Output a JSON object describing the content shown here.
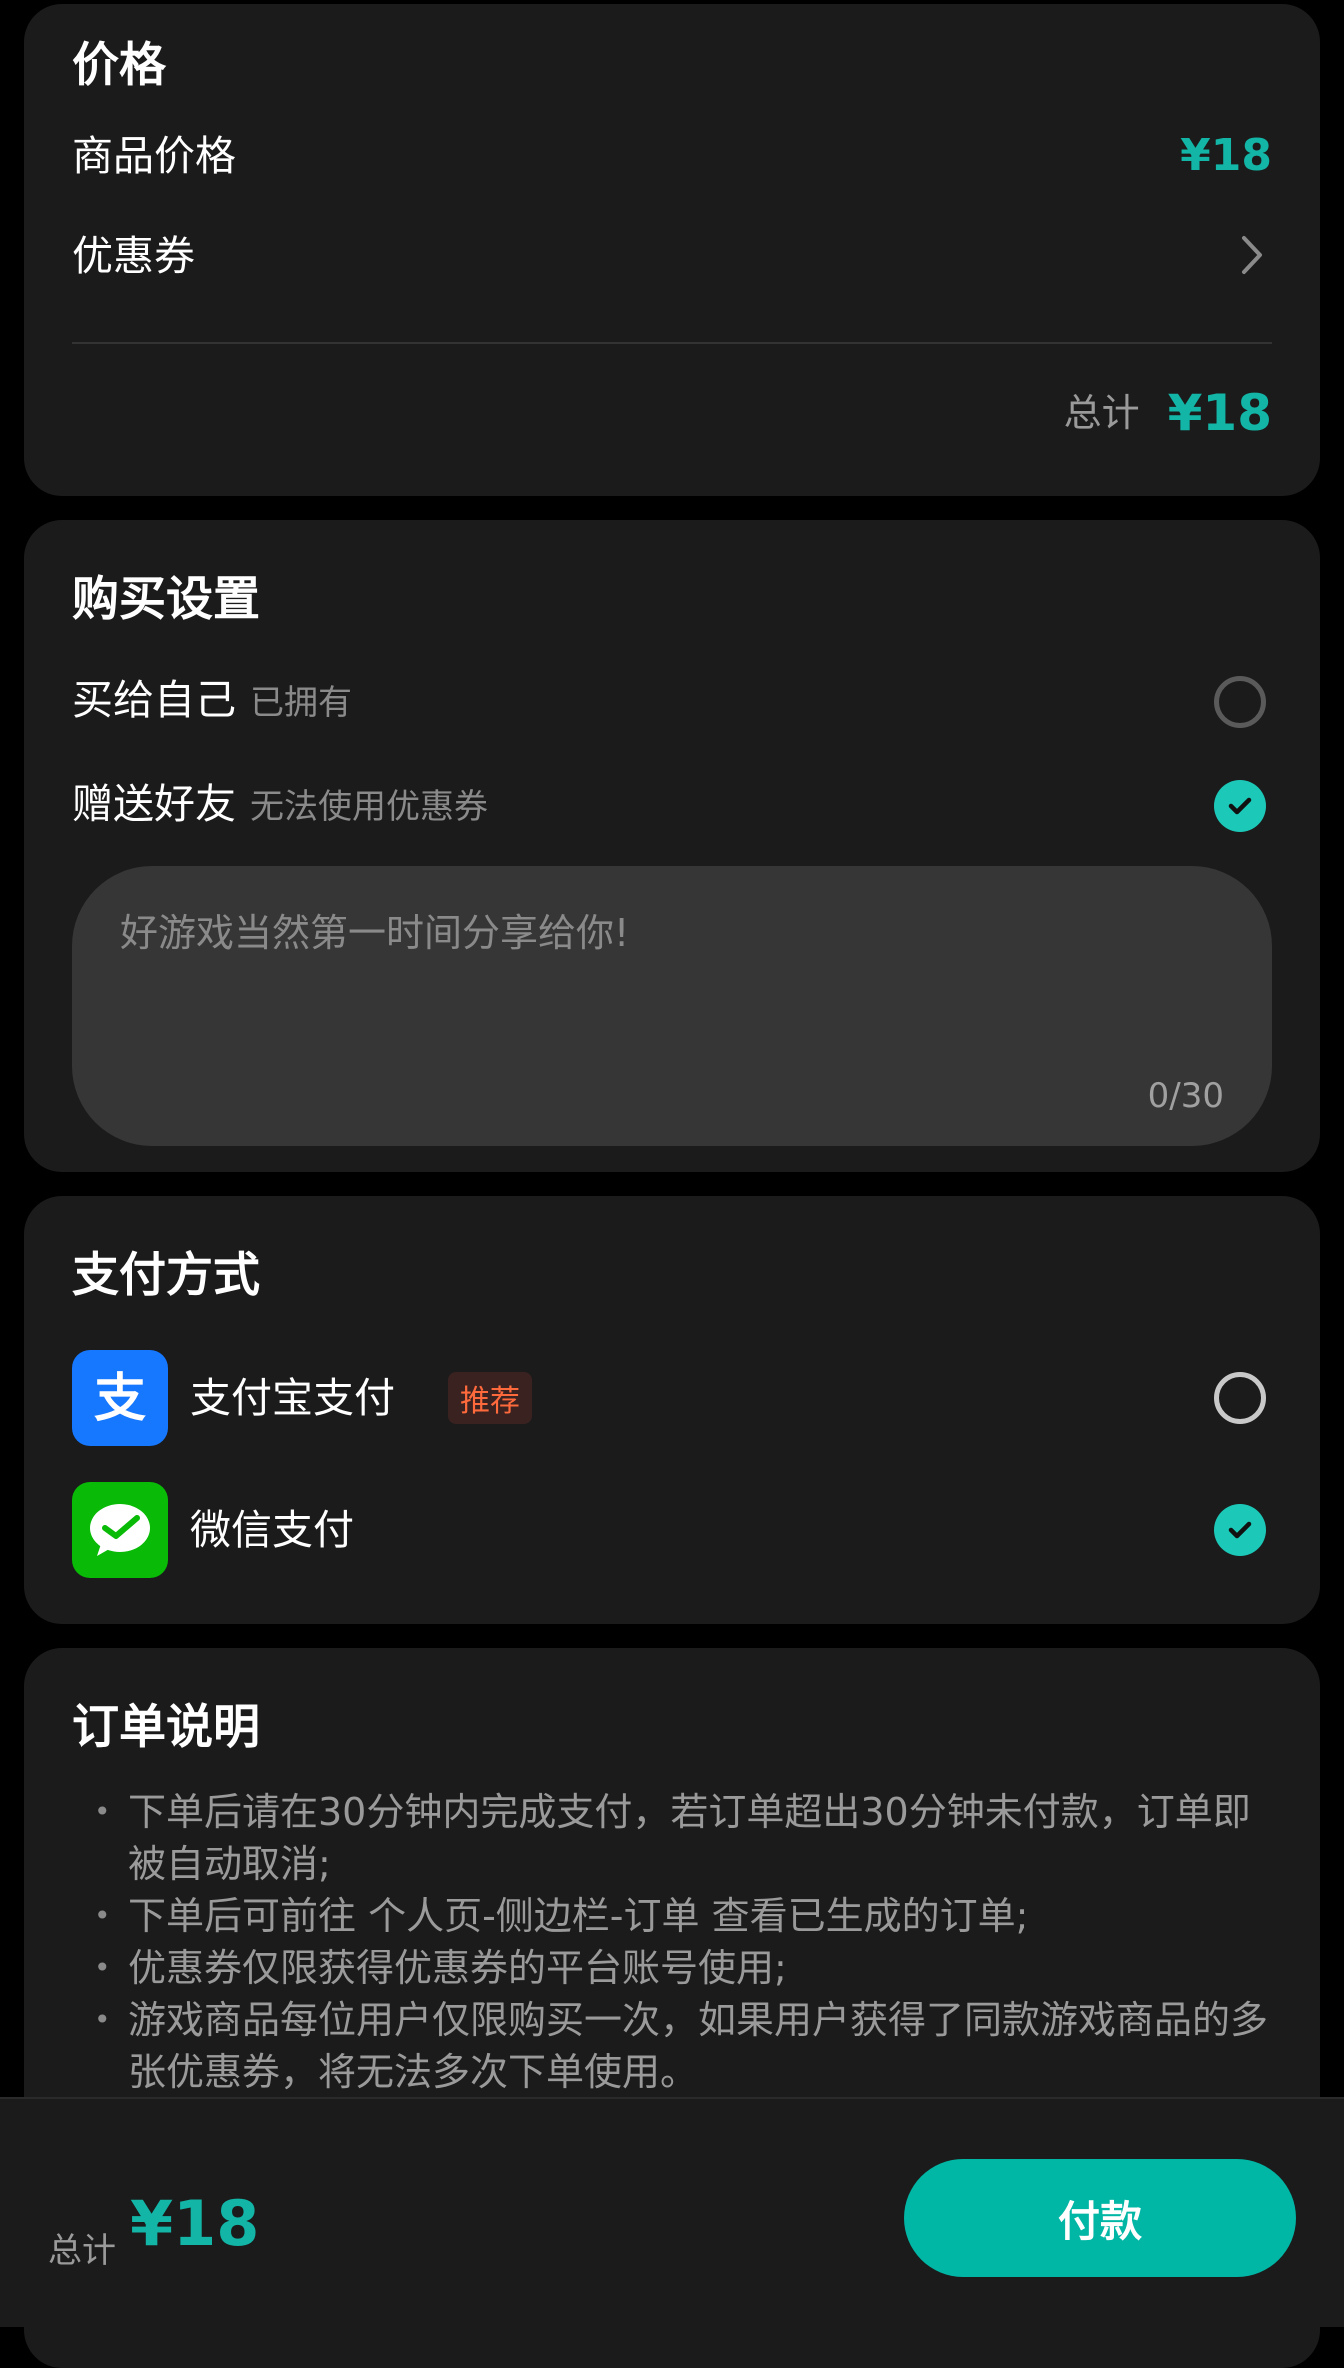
{
  "price": {
    "title": "价格",
    "product_price_label": "商品价格",
    "product_price_value": "¥18",
    "coupon_label": "优惠券",
    "total_label": "总计",
    "total_value": "¥18"
  },
  "purchase": {
    "title": "购买设置",
    "options": [
      {
        "label": "买给自己",
        "note": "已拥有",
        "selected": false
      },
      {
        "label": "赠送好友",
        "note": "无法使用优惠券",
        "selected": true
      }
    ],
    "message_placeholder": "好游戏当然第一时间分享给你!",
    "message_count": "0/30"
  },
  "payment": {
    "title": "支付方式",
    "methods": [
      {
        "label": "支付宝支付",
        "badge": "推荐",
        "icon": "alipay-icon",
        "color": "#1677ff",
        "selected": false
      },
      {
        "label": "微信支付",
        "icon": "wechat-pay-icon",
        "color": "#09bb07",
        "selected": true
      }
    ]
  },
  "notes": {
    "title": "订单说明",
    "items": [
      "下单后请在30分钟内完成支付，若订单超出30分钟未付款，订单即被自动取消;",
      "下单后可前往 个人页-侧边栏-订单 查看已生成的订单;",
      "优惠券仅限获得优惠券的平台账号使用;",
      "游戏商品每位用户仅限购买一次，如果用户获得了同款游戏商品的多张优惠券，将无法多次下单使用。"
    ]
  },
  "bottom_bar": {
    "total_label": "总计",
    "total_value": "¥18",
    "pay_label": "付款"
  },
  "colors": {
    "accent": "#12b5a6",
    "card_bg": "#1b1b1b",
    "check": "#1cc9b8"
  }
}
